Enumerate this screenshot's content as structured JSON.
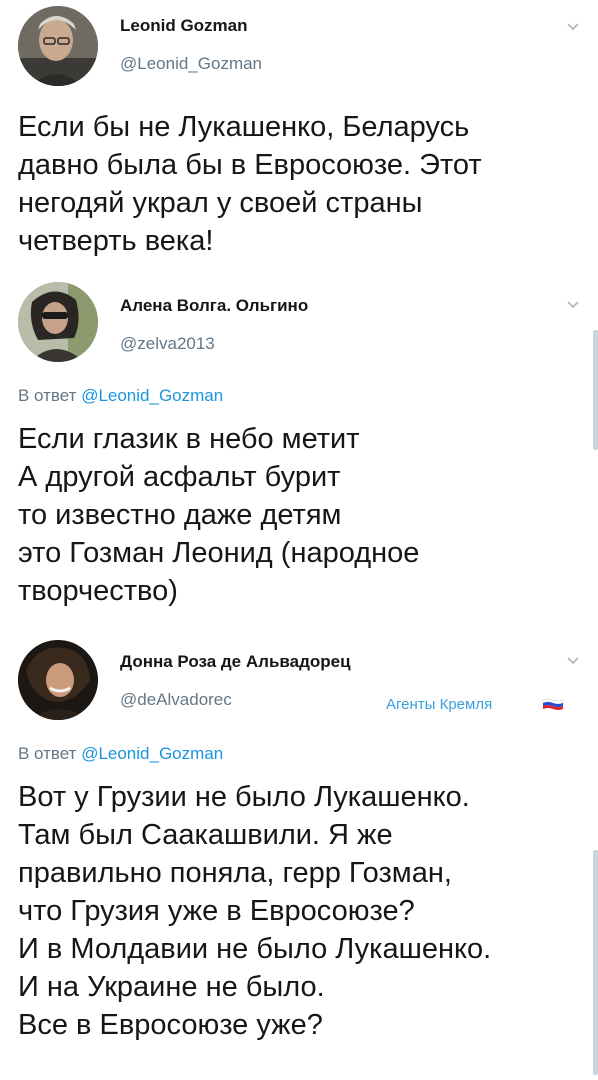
{
  "tweets": [
    {
      "name": "Leonid Gozman",
      "handle": "@Leonid_Gozman",
      "body_lines": [
        "Если бы не Лукашенко, Беларусь",
        "давно была бы в Евросоюзе. Этот",
        "негодяй украл у своей страны",
        "четверть века!"
      ]
    },
    {
      "name": "Алена Волга. Ольгино",
      "handle": "@zelva2013",
      "reply_prefix": "В ответ",
      "reply_to": "@Leonid_Gozman",
      "body_lines": [
        "Если глазик в небо метит",
        "А другой асфальт бурит",
        "то известно даже детям",
        "это Гозман Леонид (народное",
        "творчество)"
      ]
    },
    {
      "name": "Донна Роза де Альвадорец",
      "handle": "@deAlvadorec",
      "badge": "Агенты Кремля",
      "reply_prefix": "В ответ",
      "reply_to": "@Leonid_Gozman",
      "body_lines": [
        "Вот у Грузии не было Лукашенко.",
        "Там был Саакашвили. Я же",
        "правильно поняла, герр Гозман,",
        "что Грузия уже в Евросоюзе?",
        "И в Молдавии не было Лукашенко.",
        "И на Украине не было.",
        "Все в Евросоюзе уже?"
      ]
    }
  ],
  "colors": {
    "text": "#14171a",
    "secondary": "#657786",
    "link": "#1b95e0",
    "badge": "#3aa0e0"
  },
  "icons": [
    "chevron-down-icon",
    "russian-flag-icon"
  ]
}
